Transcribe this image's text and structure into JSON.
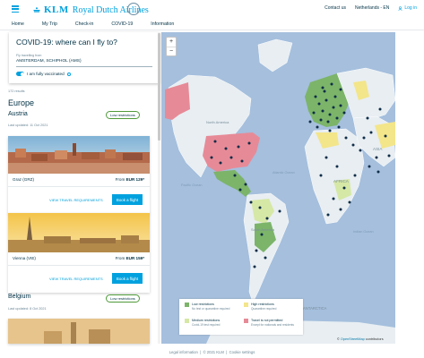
{
  "brand": {
    "name": "KLM",
    "tagline": "Royal Dutch Airlines"
  },
  "header": {
    "contact": "Contact us",
    "locale": "Netherlands - EN",
    "login": "Log in"
  },
  "nav": {
    "items": [
      "Home",
      "My Trip",
      "Check-in",
      "COVID-19",
      "Information"
    ]
  },
  "search": {
    "title": "COVID-19: where can I fly to?",
    "from_label": "Fly travelling from",
    "from_value": "AMSTERDAM, Schiphol (AMS)",
    "vaccinated_label": "I am fully vaccinated",
    "vaccinated": true
  },
  "results": {
    "count": "172 results",
    "region": "Europe",
    "groups": [
      {
        "country": "Austria",
        "badge": "Low restrictions",
        "updated": "Last updated: 11 Oct 2021",
        "cards": [
          {
            "name": "Graz (GRZ)",
            "price_prefix": "From",
            "price": "EUR 129*",
            "link": "VIEW TRAVEL REQUIREMENTS",
            "button": "Book a flight"
          },
          {
            "name": "Vienna (VIE)",
            "price_prefix": "From",
            "price": "EUR 159*",
            "link": "VIEW TRAVEL REQUIREMENTS",
            "button": "Book a flight"
          }
        ]
      },
      {
        "country": "Belgium",
        "badge": "Low restrictions",
        "updated": "Last updated: 8 Oct 2021"
      }
    ]
  },
  "map": {
    "zoom_in": "+",
    "zoom_out": "−",
    "labels": {
      "north_america": "North America",
      "south_america": "South America",
      "africa": "AFRICA",
      "asia": "ASIA",
      "antarctica": "ANTARCTICA",
      "pacific": "Pacific Ocean",
      "atlantic": "Atlantic Ocean",
      "indian": "Indian Ocean"
    },
    "colors": {
      "low": "#7cb46a",
      "high": "#f3e58a",
      "medium": "#d6e8a5",
      "not_permitted": "#e78a97",
      "water": "#a5bfdd",
      "land": "#e8eef2",
      "marker": "#0f2d48"
    },
    "legend": [
      {
        "title": "Low restrictions",
        "sub": "No test or quarantine required"
      },
      {
        "title": "High restrictions",
        "sub": "Quarantine required"
      },
      {
        "title": "Medium restrictions",
        "sub": "Covid-19 test required"
      },
      {
        "title": "Travel is not permitted",
        "sub": "Except for nationals and residents"
      }
    ],
    "attribution_prefix": "©",
    "attribution_link": "OpenStreetMap",
    "attribution_suffix": "contributors"
  },
  "footer": {
    "legal": "Legal information",
    "copyright": "© 2021 KLM",
    "cookies": "Cookie settings"
  }
}
